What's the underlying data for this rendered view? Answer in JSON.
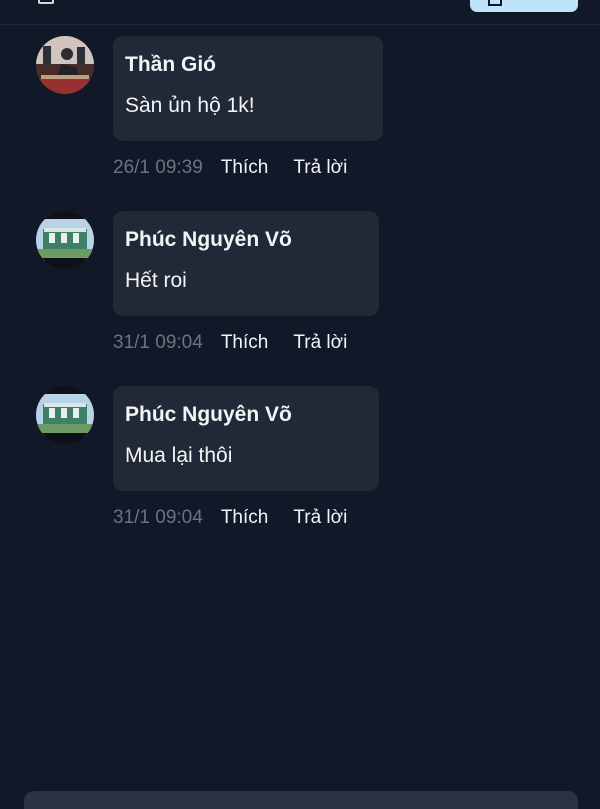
{
  "colors": {
    "background": "#111827",
    "bubble": "#212937",
    "text": "#f3f4f6",
    "muted": "#6b7280",
    "accent": "#bfe3f8"
  },
  "comments": [
    {
      "author": "Thần Gió",
      "message": "Sàn ủn hộ 1k!",
      "timestamp": "26/1 09:39",
      "like_label": "Thích",
      "reply_label": "Trả lời",
      "avatar": "person-photo"
    },
    {
      "author": "Phúc Nguyên Võ",
      "message": "Hết roi",
      "timestamp": "31/1 09:04",
      "like_label": "Thích",
      "reply_label": "Trả lời",
      "avatar": "house-photo"
    },
    {
      "author": "Phúc Nguyên Võ",
      "message": "Mua lại thôi",
      "timestamp": "31/1 09:04",
      "like_label": "Thích",
      "reply_label": "Trả lời",
      "avatar": "house-photo"
    }
  ]
}
